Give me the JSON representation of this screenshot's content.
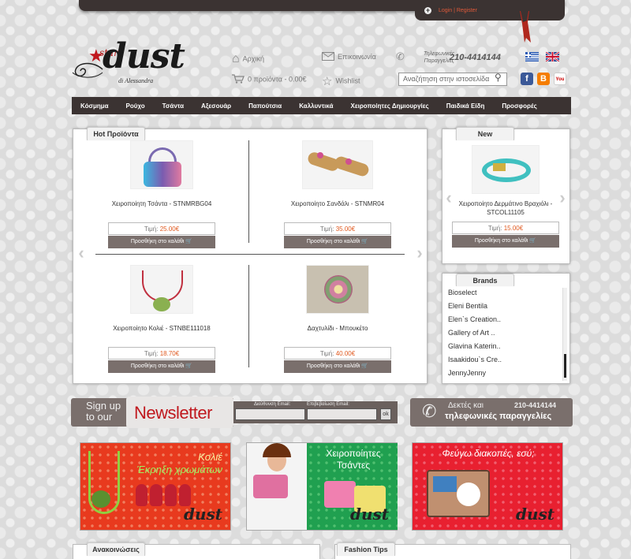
{
  "header": {
    "login": "Login | Register",
    "home": "Αρχική",
    "contact": "Επικοινωνία",
    "cart": "0 προϊόντα - 0.00€",
    "wishlist": "Wishlist",
    "phone_label": "Τηλεφωνικές Παραγγελίες",
    "phone": "210-4414144",
    "search_placeholder": "Αναζήτηση στην ιστοσελίδα"
  },
  "logo": {
    "dust": "dust",
    "star": "star",
    "di": "di Alessandra"
  },
  "nav": [
    "Κόσμημα",
    "Ρούχο",
    "Τσάντα",
    "Αξεσουάρ",
    "Παπούτσια",
    "Καλλυντικά",
    "Χειροποίητες Δημιουργίες",
    "Παιδικά Είδη",
    "Προσφορές"
  ],
  "hot": {
    "title": "Hot Προϊόντα",
    "price_label": "Τιμή:",
    "cart_label": "Προσθήκη στο καλάθι",
    "products": [
      {
        "name": "Χειροποίητη Τσάντα - STNMRBG04",
        "price": "25.00€"
      },
      {
        "name": "Χειροποίητο Σανδάλι - STNMR04",
        "price": "35.00€"
      },
      {
        "name": "Χειροποίητο Κολιέ - STNBE111018",
        "price": "18.70€"
      },
      {
        "name": "Δαχτυλίδι - Μπουκέτο",
        "price": "40.00€"
      }
    ]
  },
  "new": {
    "title": "New",
    "product": {
      "name": "Χειροποίητο Δερμάτινο Βραχιόλι - STCOL11105",
      "price": "15.00€"
    }
  },
  "brands": {
    "title": "Brands",
    "items": [
      "Bioselect",
      "Eleni Bentila",
      "Elen`s Creation..",
      "Gallery of Art ..",
      "Glavina Katerin..",
      "Isaakidou`s Cre..",
      "JennyJenny"
    ]
  },
  "newsletter": {
    "signup": "Sign up to our",
    "title": "Newsletter",
    "email_label": "Διεύθυνση Email:",
    "confirm_label": "Επιβεβαίωση Email:",
    "ok": "ok",
    "phone_label_1": "Δεκτές και",
    "phone_label_2": "τηλεφωνικές παραγγελίες",
    "phone": "210-4414144"
  },
  "banners": [
    {
      "line1": "Κολιέ",
      "line2": "Έκρηξη χρωμάτων",
      "logo": "dust"
    },
    {
      "line1": "Χειροποίητες",
      "line2": "Τσάντες",
      "logo": "dust"
    },
    {
      "line1": "Φεύγω διακοπές, εσύ;",
      "line2": "",
      "logo": "dust"
    }
  ],
  "bottom": {
    "announcements": "Ανακοινώσεις",
    "tips": "Fashion Tips"
  }
}
